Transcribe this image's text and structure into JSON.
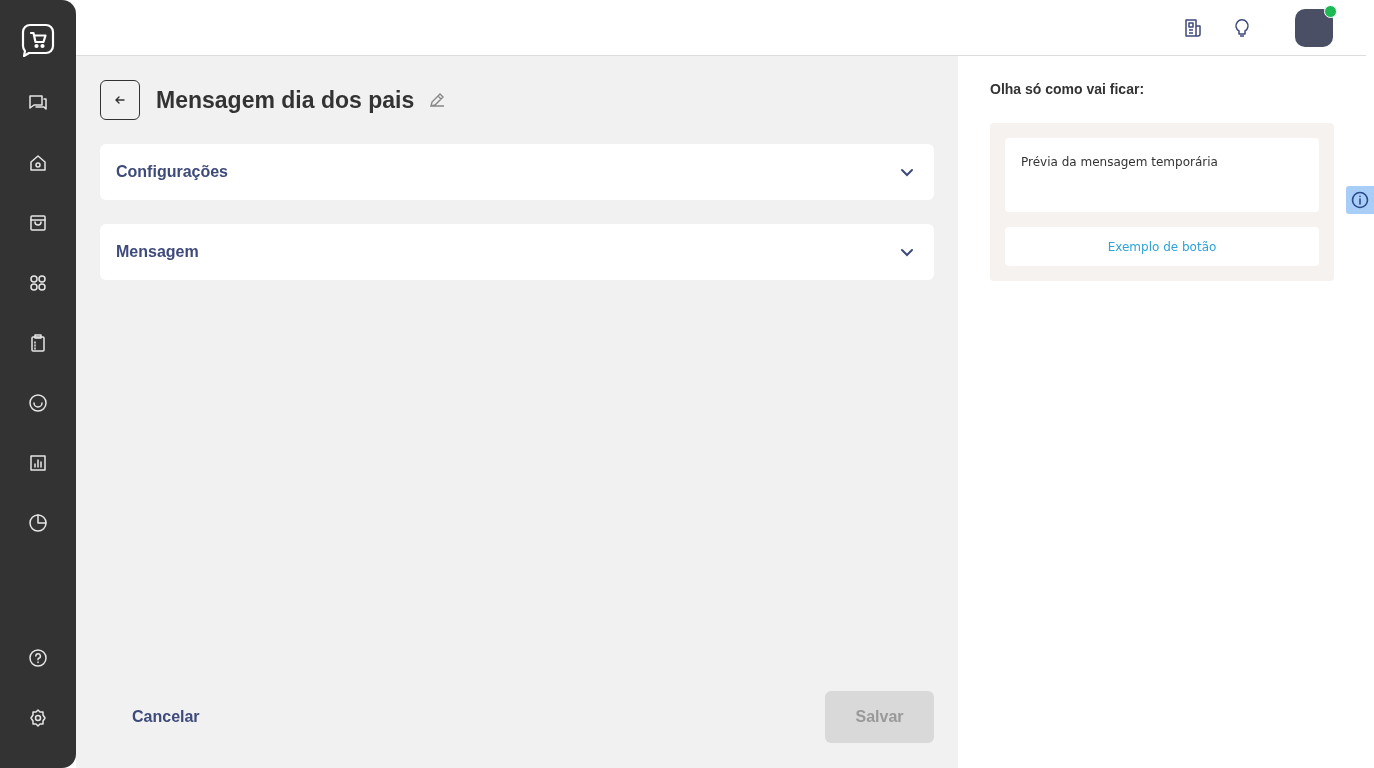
{
  "sidebar": {
    "top_items": [
      {
        "kind": "chat"
      },
      {
        "kind": "home"
      },
      {
        "kind": "bag"
      },
      {
        "kind": "apps"
      },
      {
        "kind": "clipboard"
      },
      {
        "kind": "smile"
      },
      {
        "kind": "chart"
      },
      {
        "kind": "pie"
      }
    ],
    "bottom_items": [
      {
        "kind": "help"
      },
      {
        "kind": "settings"
      }
    ]
  },
  "header": {
    "avatar": {
      "online": true
    }
  },
  "page": {
    "title": "Mensagem dia dos pais",
    "sections": [
      {
        "title": "Configurações",
        "expanded": false
      },
      {
        "title": "Mensagem",
        "expanded": false
      }
    ],
    "cancel": "Cancelar",
    "save": {
      "label": "Salvar",
      "disabled": true
    }
  },
  "preview": {
    "heading": "Olha só como vai ficar:",
    "message": "Prévia da mensagem temporária",
    "button": "Exemplo de botão"
  }
}
